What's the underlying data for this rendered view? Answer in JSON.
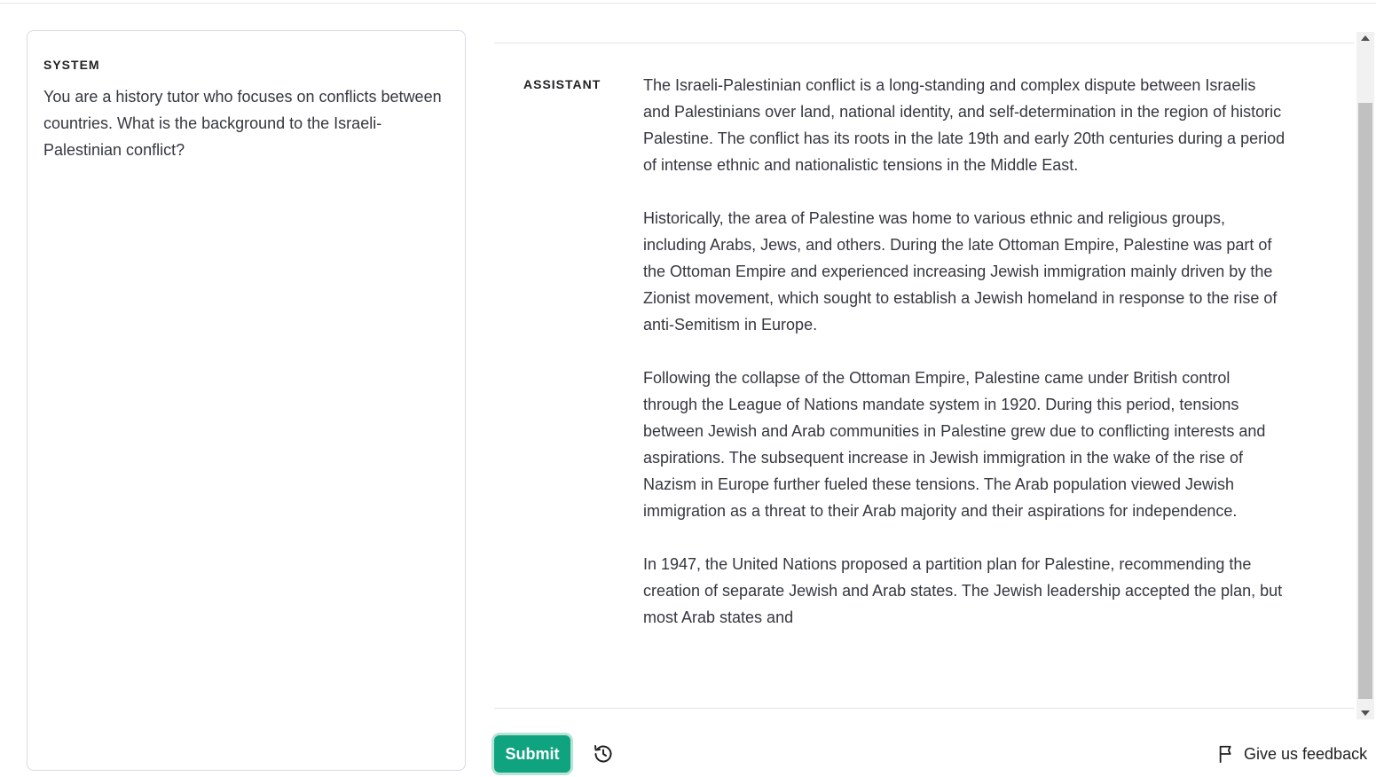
{
  "system": {
    "label": "SYSTEM",
    "text": "You are a history tutor who focuses on conflicts between countries. What is the background to the Israeli-Palestinian conflict?"
  },
  "assistant": {
    "label": "ASSISTANT",
    "paragraphs": [
      "The Israeli-Palestinian conflict is a long-standing and complex dispute between Israelis and Palestinians over land, national identity, and self-determination in the region of historic Palestine. The conflict has its roots in the late 19th and early 20th centuries during a period of intense ethnic and nationalistic tensions in the Middle East.",
      "Historically, the area of Palestine was home to various ethnic and religious groups, including Arabs, Jews, and others. During the late Ottoman Empire, Palestine was part of the Ottoman Empire and experienced increasing Jewish immigration mainly driven by the Zionist movement, which sought to establish a Jewish homeland in response to the rise of anti-Semitism in Europe.",
      "Following the collapse of the Ottoman Empire, Palestine came under British control through the League of Nations mandate system in 1920. During this period, tensions between Jewish and Arab communities in Palestine grew due to conflicting interests and aspirations. The subsequent increase in Jewish immigration in the wake of the rise of Nazism in Europe further fueled these tensions. The Arab population viewed Jewish immigration as a threat to their Arab majority and their aspirations for independence.",
      "In 1947, the United Nations proposed a partition plan for Palestine, recommending the creation of separate Jewish and Arab states. The Jewish leadership accepted the plan, but most Arab states and"
    ]
  },
  "footer": {
    "submit_label": "Submit",
    "history_icon": "history-icon",
    "feedback_label": "Give us feedback",
    "feedback_icon": "flag-icon"
  },
  "colors": {
    "accent": "#10a37f",
    "text": "#353740"
  }
}
